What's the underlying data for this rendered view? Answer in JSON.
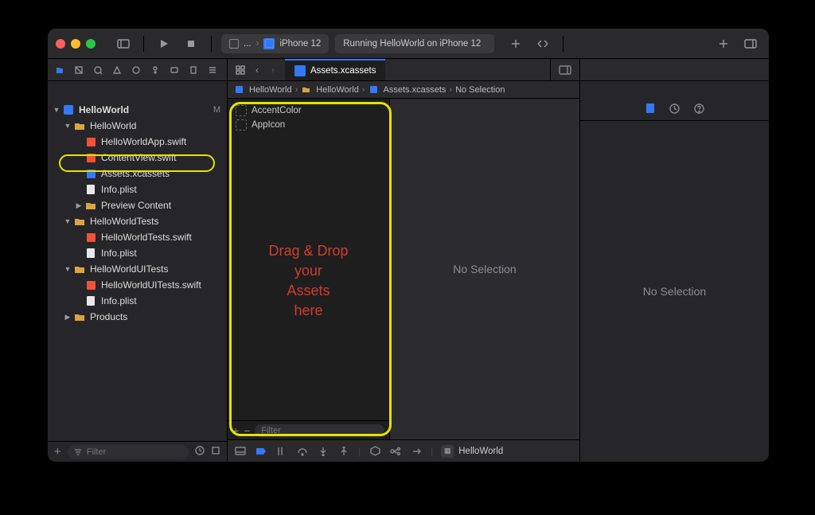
{
  "toolbar": {
    "scheme_app_short": "...",
    "scheme_device": "iPhone 12",
    "status_text": "Running HelloWorld on iPhone 12"
  },
  "tab": {
    "active_file": "Assets.xcassets"
  },
  "breadcrumb": {
    "items": [
      "HelloWorld",
      "HelloWorld",
      "Assets.xcassets",
      "No Selection"
    ]
  },
  "navigator": {
    "root": {
      "name": "HelloWorld",
      "status": "M"
    },
    "groups": [
      {
        "name": "HelloWorld",
        "open": true,
        "children": [
          {
            "name": "HelloWorldApp.swift",
            "kind": "swift"
          },
          {
            "name": "ContentView.swift",
            "kind": "swift"
          },
          {
            "name": "Assets.xcassets",
            "kind": "assets",
            "selected": true
          },
          {
            "name": "Info.plist",
            "kind": "plist"
          },
          {
            "name": "Preview Content",
            "kind": "folder",
            "closed": true
          }
        ]
      },
      {
        "name": "HelloWorldTests",
        "open": true,
        "children": [
          {
            "name": "HelloWorldTests.swift",
            "kind": "swift"
          },
          {
            "name": "Info.plist",
            "kind": "plist"
          }
        ]
      },
      {
        "name": "HelloWorldUITests",
        "open": true,
        "children": [
          {
            "name": "HelloWorldUITests.swift",
            "kind": "swift"
          },
          {
            "name": "Info.plist",
            "kind": "plist"
          }
        ]
      },
      {
        "name": "Products",
        "open": false,
        "children": []
      }
    ],
    "filter_placeholder": "Filter"
  },
  "assetlist": {
    "items": [
      "AccentColor",
      "AppIcon"
    ],
    "filter_placeholder": "Filter",
    "overlay": "Drag & Drop\nyour\nAssets\nhere"
  },
  "preview": {
    "placeholder": "No Selection"
  },
  "inspector": {
    "placeholder": "No Selection"
  },
  "debug": {
    "app_name": "HelloWorld"
  },
  "colors": {
    "accent": "#3478f6",
    "highlight_ring": "#e5e200",
    "overlay_text": "#d13c30"
  }
}
